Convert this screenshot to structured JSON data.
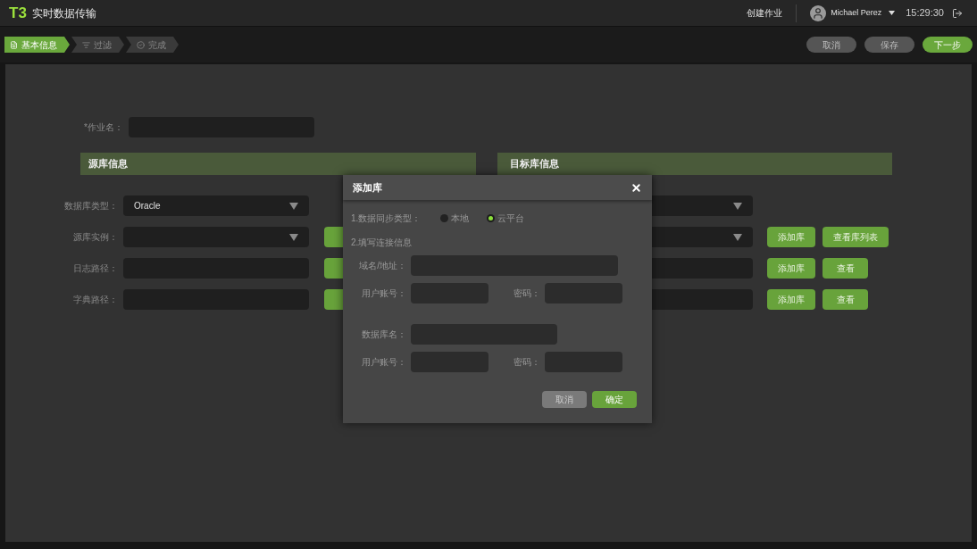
{
  "app": {
    "logo": "T3",
    "title": "实时数据传输"
  },
  "header": {
    "create_job": "创建作业",
    "user": "Michael Perez",
    "time": "15:29:30"
  },
  "steps": [
    {
      "label": "基本信息",
      "kind": "doc",
      "selected": true
    },
    {
      "label": "过滤",
      "kind": "filter",
      "selected": false
    },
    {
      "label": "完成",
      "kind": "check",
      "selected": false
    }
  ],
  "actions": [
    {
      "label": "取消",
      "kind": "secondary"
    },
    {
      "label": "保存",
      "kind": "secondary"
    },
    {
      "label": "下一步",
      "kind": "primary"
    }
  ],
  "job_name": {
    "label": "*作业名："
  },
  "source": {
    "title": "源库信息",
    "rows": [
      {
        "label": "数据库类型：",
        "kind": "select",
        "value": "Oracle",
        "side_button": false
      },
      {
        "label": "源库实例：",
        "kind": "select",
        "side_button": true
      },
      {
        "label": "日志路径：",
        "kind": "input",
        "side_button": true
      },
      {
        "label": "字典路径：",
        "kind": "input",
        "side_button": true
      }
    ]
  },
  "target": {
    "title": "目标库信息",
    "rows": [
      {
        "kind": "select",
        "buttons": []
      },
      {
        "kind": "select",
        "buttons": [
          "添加库",
          "查看库列表"
        ]
      },
      {
        "kind": "input",
        "buttons": [
          "添加库",
          "查看"
        ]
      },
      {
        "kind": "input",
        "buttons": [
          "添加库",
          "查看"
        ]
      }
    ]
  },
  "dialog": {
    "title": "添加库",
    "sync_label": "1.数据同步类型：",
    "options": [
      {
        "label": "本地",
        "selected": false
      },
      {
        "label": "云平台",
        "selected": true
      }
    ],
    "section_label": "2.填写连接信息",
    "rows": [
      {
        "fields": [
          {
            "label": "域名/地址：",
            "kind": "wide"
          }
        ],
        "spaced": false
      },
      {
        "fields": [
          {
            "label": "用户账号：",
            "kind": "small"
          },
          {
            "label": "密码：",
            "kind": "small"
          }
        ],
        "spaced": false
      },
      {
        "fields": [
          {
            "label": "数据库名：",
            "kind": "medium"
          }
        ],
        "spaced": true
      },
      {
        "fields": [
          {
            "label": "用户账号：",
            "kind": "small"
          },
          {
            "label": "密码：",
            "kind": "small"
          }
        ],
        "spaced": false
      }
    ],
    "buttons": [
      {
        "label": "取消",
        "kind": "secondary"
      },
      {
        "label": "确定",
        "kind": "primary"
      }
    ]
  }
}
